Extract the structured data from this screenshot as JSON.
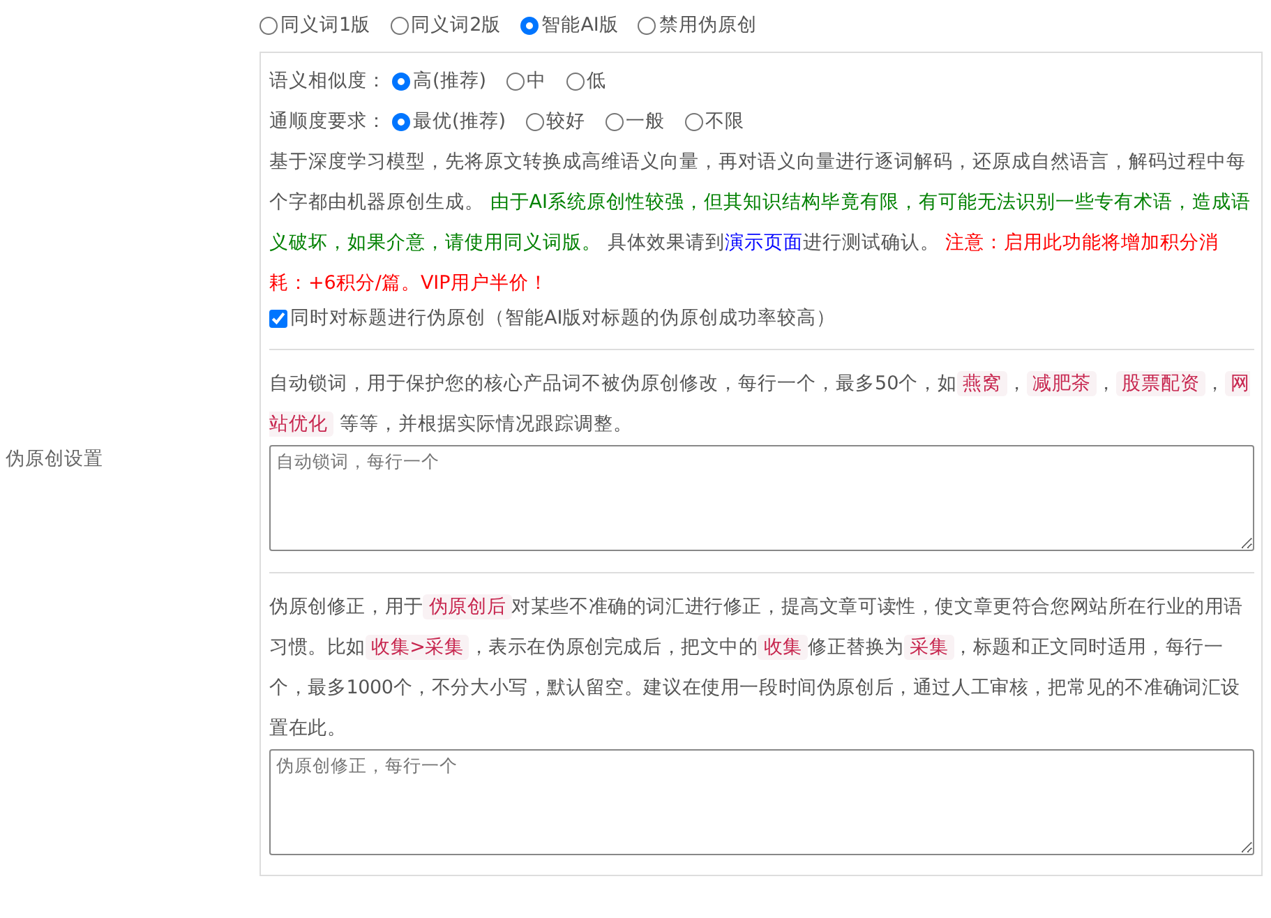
{
  "section_label": "伪原创设置",
  "modes": [
    {
      "label": "同义词1版",
      "selected": false
    },
    {
      "label": "同义词2版",
      "selected": false
    },
    {
      "label": "智能AI版",
      "selected": true
    },
    {
      "label": "禁用伪原创",
      "selected": false
    }
  ],
  "option_groups": [
    {
      "label": "语义相似度：",
      "options": [
        {
          "label": "高(推荐)",
          "selected": true
        },
        {
          "label": "中",
          "selected": false
        },
        {
          "label": "低",
          "selected": false
        }
      ]
    },
    {
      "label": "通顺度要求：",
      "options": [
        {
          "label": "最优(推荐)",
          "selected": true
        },
        {
          "label": "较好",
          "selected": false
        },
        {
          "label": "一般",
          "selected": false
        },
        {
          "label": "不限",
          "selected": false
        }
      ]
    }
  ],
  "ai_description": [
    {
      "kind": "plain",
      "text": "基于深度学习模型，先将原文转换成高维语义向量，再对语义向量进行逐词解码，还原成自然语言，解码过程中每个字都由机器原创生成。"
    },
    {
      "kind": "green",
      "text": " 由于AI系统原创性较强，但其知识结构毕竟有限，有可能无法识别一些专有术语，造成语义破坏，如果介意，请使用同义词版。"
    },
    {
      "kind": "plain",
      "text": " 具体效果请到"
    },
    {
      "kind": "link",
      "text": "演示页面"
    },
    {
      "kind": "plain",
      "text": "进行测试确认。"
    },
    {
      "kind": "red",
      "text": " 注意：启用此功能将增加积分消耗：+6积分/篇。VIP用户半价！"
    }
  ],
  "title_option": {
    "label": "同时对标题进行伪原创（智能AI版对标题的伪原创成功率较高）",
    "checked": true
  },
  "lock_words": {
    "description": [
      {
        "kind": "plain",
        "text": "自动锁词，用于保护您的核心产品词不被伪原创修改，每行一个，最多50个，如"
      },
      {
        "kind": "code",
        "text": "燕窝"
      },
      {
        "kind": "plain",
        "text": "，"
      },
      {
        "kind": "code",
        "text": "减肥茶"
      },
      {
        "kind": "plain",
        "text": "，"
      },
      {
        "kind": "code",
        "text": "股票配资"
      },
      {
        "kind": "plain",
        "text": "，"
      },
      {
        "kind": "code",
        "text": "网站优化"
      },
      {
        "kind": "plain",
        "text": " 等等，并根据实际情况跟踪调整。"
      }
    ],
    "placeholder": "自动锁词，每行一个"
  },
  "corrections": {
    "description": [
      {
        "kind": "plain",
        "text": "伪原创修正，用于"
      },
      {
        "kind": "code",
        "text": "伪原创后"
      },
      {
        "kind": "plain",
        "text": "对某些不准确的词汇进行修正，提高文章可读性，使文章更符合您网站所在行业的用语习惯。比如"
      },
      {
        "kind": "code",
        "text": "收集>采集"
      },
      {
        "kind": "plain",
        "text": "，表示在伪原创完成后，把文中的"
      },
      {
        "kind": "code",
        "text": "收集"
      },
      {
        "kind": "plain",
        "text": "修正替换为"
      },
      {
        "kind": "code",
        "text": "采集"
      },
      {
        "kind": "plain",
        "text": "，标题和正文同时适用，每行一个，最多1000个，不分大小写，默认留空。建议在使用一段时间伪原创后，通过人工审核，把常见的不准确词汇设置在此。"
      }
    ],
    "placeholder": "伪原创修正，每行一个"
  }
}
